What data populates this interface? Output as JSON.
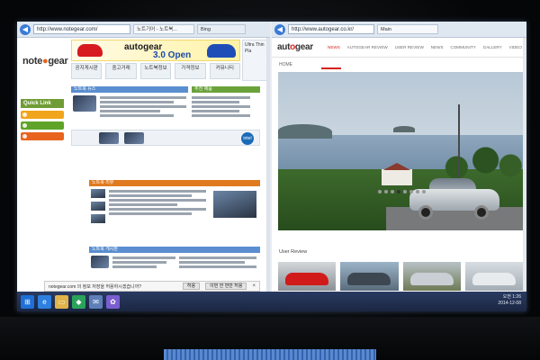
{
  "left_window": {
    "address": "http://www.notegear.com/",
    "tab_title": "노트기어 - 노트북...",
    "tab_inactive": "Bing",
    "logo_note": "note",
    "logo_gear": "gear",
    "banner_logo": "autogear",
    "banner_text": "3.0 Open",
    "nav": [
      "공지게시판",
      "중고거래",
      "노트북정보",
      "가격정보",
      "커뮤니티"
    ],
    "quick_link_title": "Quick Link",
    "quick_links": [
      "",
      "",
      ""
    ],
    "panel_titles": [
      "노트북 뉴스",
      "추천 제품",
      "노트북 리뷰",
      "노트북 게시판"
    ],
    "intel_label": "intel",
    "side_ad": "Ultra Thin Pla"
  },
  "right_window": {
    "address": "http://www.autogear.co.kr/",
    "tab_title": "Main",
    "logo_prefix": "aut",
    "logo_o": "o",
    "logo_suffix": "gear",
    "nav": [
      "NEWS",
      "AUTOGEAR REVIEW",
      "USER REVIEW",
      "NEWS",
      "COMMUNITY",
      "GALLERY",
      "VIDEO"
    ],
    "nav_active_index": 0,
    "home_label": "HOME",
    "user_review_label": "User Review",
    "slide_count": 8,
    "slide_active": 3
  },
  "notification": {
    "message": "notegear.com 의 정보 저장을 허용하시겠습니까?",
    "buttons": [
      "허용",
      "이번 한 번만 허용"
    ],
    "close": "×"
  },
  "taskbar": {
    "icons": [
      "start-icon",
      "ie-icon",
      "folder-icon",
      "store-icon",
      "mail-icon",
      "app-icon"
    ],
    "time": "오전 1:26",
    "date": "2014-12-08"
  },
  "colors": {
    "taskbar": "#1f2d4f",
    "autogear_red": "#d4221b",
    "notegear_orange": "#e8621a",
    "quick_link_green": "#6f9c34"
  }
}
